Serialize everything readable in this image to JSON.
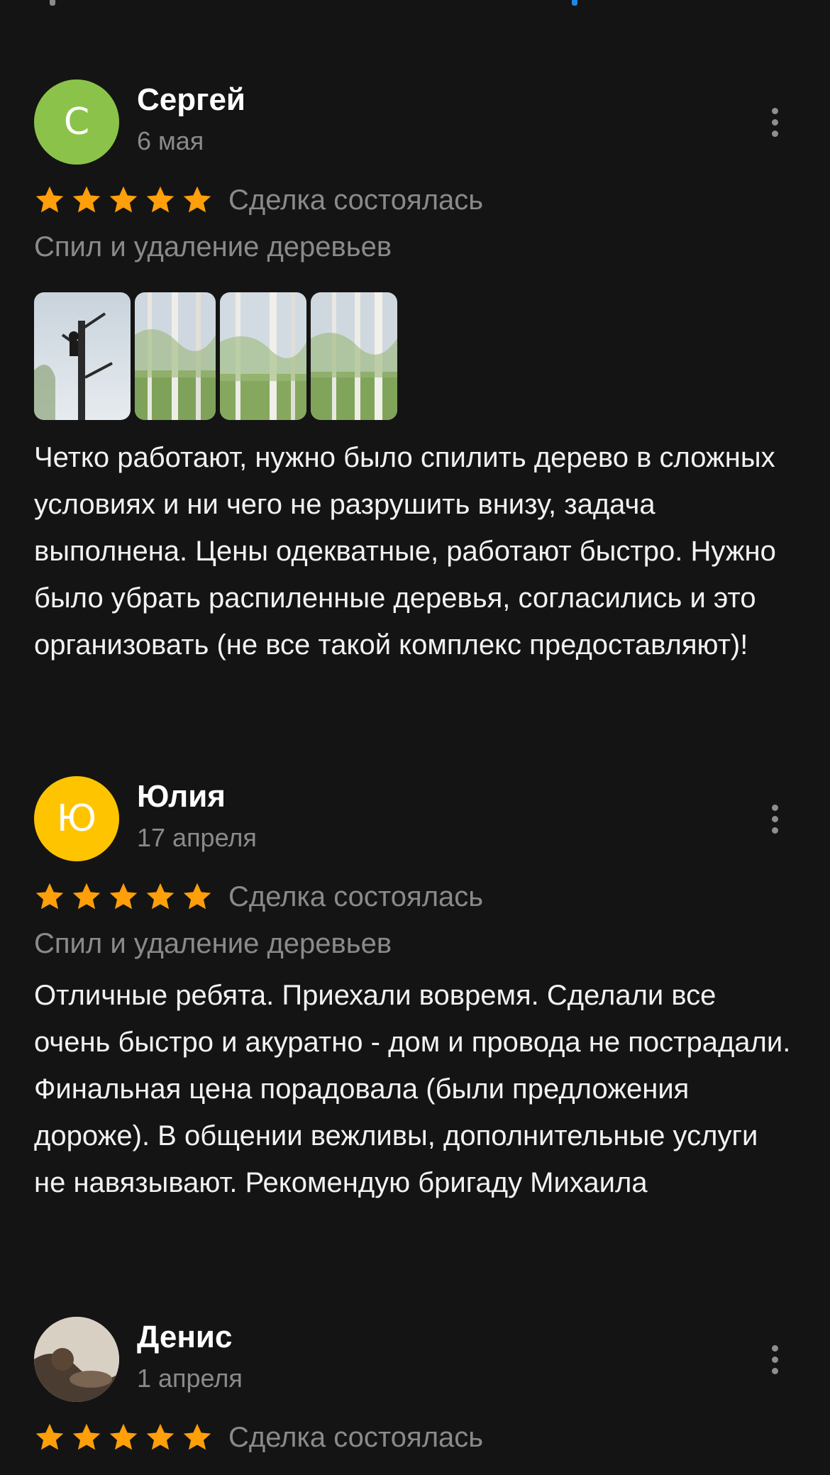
{
  "reviews": [
    {
      "author": "Сергей",
      "avatar_letter": "С",
      "avatar_color": "#8bc34a",
      "date": "6 мая",
      "rating": 5,
      "deal_status": "Сделка состоялась",
      "service": "Спил и удаление деревьев",
      "photos": [
        "tree-climber-photo",
        "birch-trees-photo-1",
        "birch-trees-photo-2",
        "birch-trees-photo-3"
      ],
      "text": "Четко работают, нужно было спилить дерево в сложных условиях и ни чего не разрушить внизу, задача выполнена. Цены одекватные, работают быстро. Нужно было убрать распиленные деревья, согласились и это организовать (не все такой комплекс предоставляют)!"
    },
    {
      "author": "Юлия",
      "avatar_letter": "Ю",
      "avatar_color": "#ffc400",
      "date": "17 апреля",
      "rating": 5,
      "deal_status": "Сделка состоялась",
      "service": "Спил и удаление деревьев",
      "text": "Отличные ребята. Приехали вовремя. Сделали все очень быстро и акуратно - дом и провода не пострадали. Финальная цена порадовала (были предложения дороже). В общении вежливы, дополнительные услуги не навязывают. Рекомендую бригаду Михаила"
    },
    {
      "author": "Денис",
      "avatar": "photo",
      "date": "1 апреля",
      "rating": 5,
      "deal_status": "Сделка состоялась"
    }
  ],
  "colors": {
    "background": "#141414",
    "star": "#ff9f0a",
    "muted_text": "#8a8a8a"
  }
}
